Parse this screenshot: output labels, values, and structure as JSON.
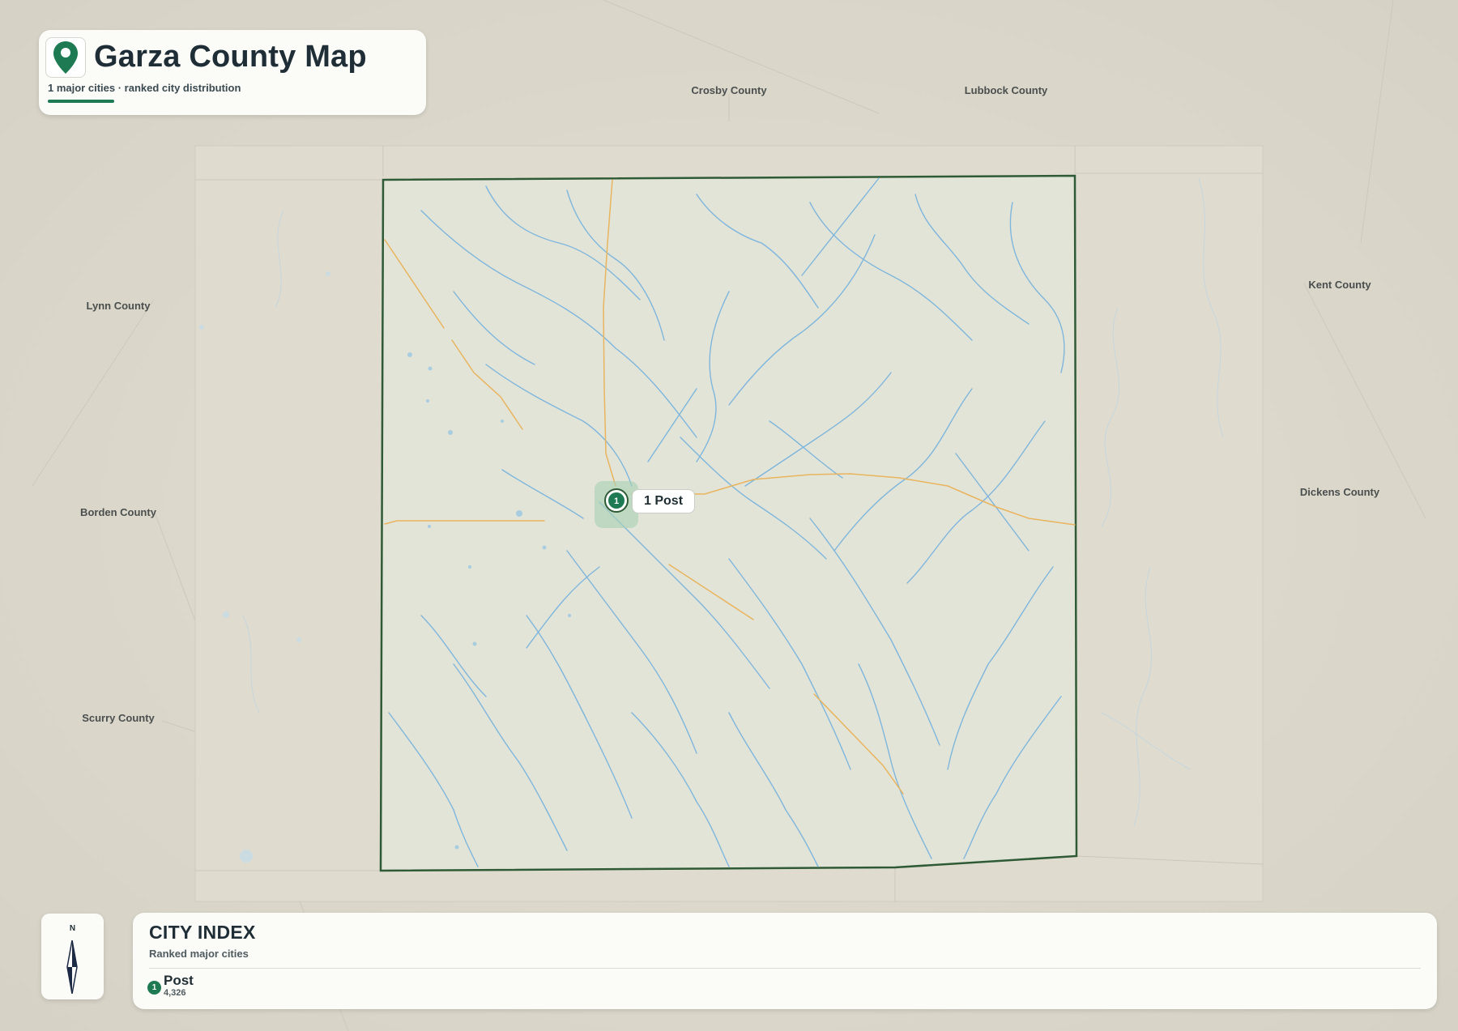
{
  "header": {
    "title": "Garza County Map",
    "subtitle": "1 major cities · ranked city distribution",
    "icon": "map-pin-icon"
  },
  "map": {
    "county": "Garza County",
    "neighbors": {
      "crosby": "Crosby County",
      "lubbock": "Lubbock County",
      "lynn": "Lynn County",
      "kent": "Kent County",
      "borden": "Borden County",
      "dickens": "Dickens County",
      "scurry": "Scurry County"
    },
    "cities": [
      {
        "rank": "1",
        "name": "Post",
        "label": "1 Post",
        "population": "4,326"
      }
    ],
    "colors": {
      "background": "#dcd8cc",
      "county_fill": "#e1e3d6",
      "county_border": "#2f5a36",
      "rivers": "#7fb6dc",
      "roads": "#e9b45e",
      "accent": "#1e7a52"
    }
  },
  "compass": {
    "north_label": "N",
    "icon": "compass-needle-icon"
  },
  "index": {
    "title": "CITY INDEX",
    "subtitle": "Ranked major cities"
  }
}
